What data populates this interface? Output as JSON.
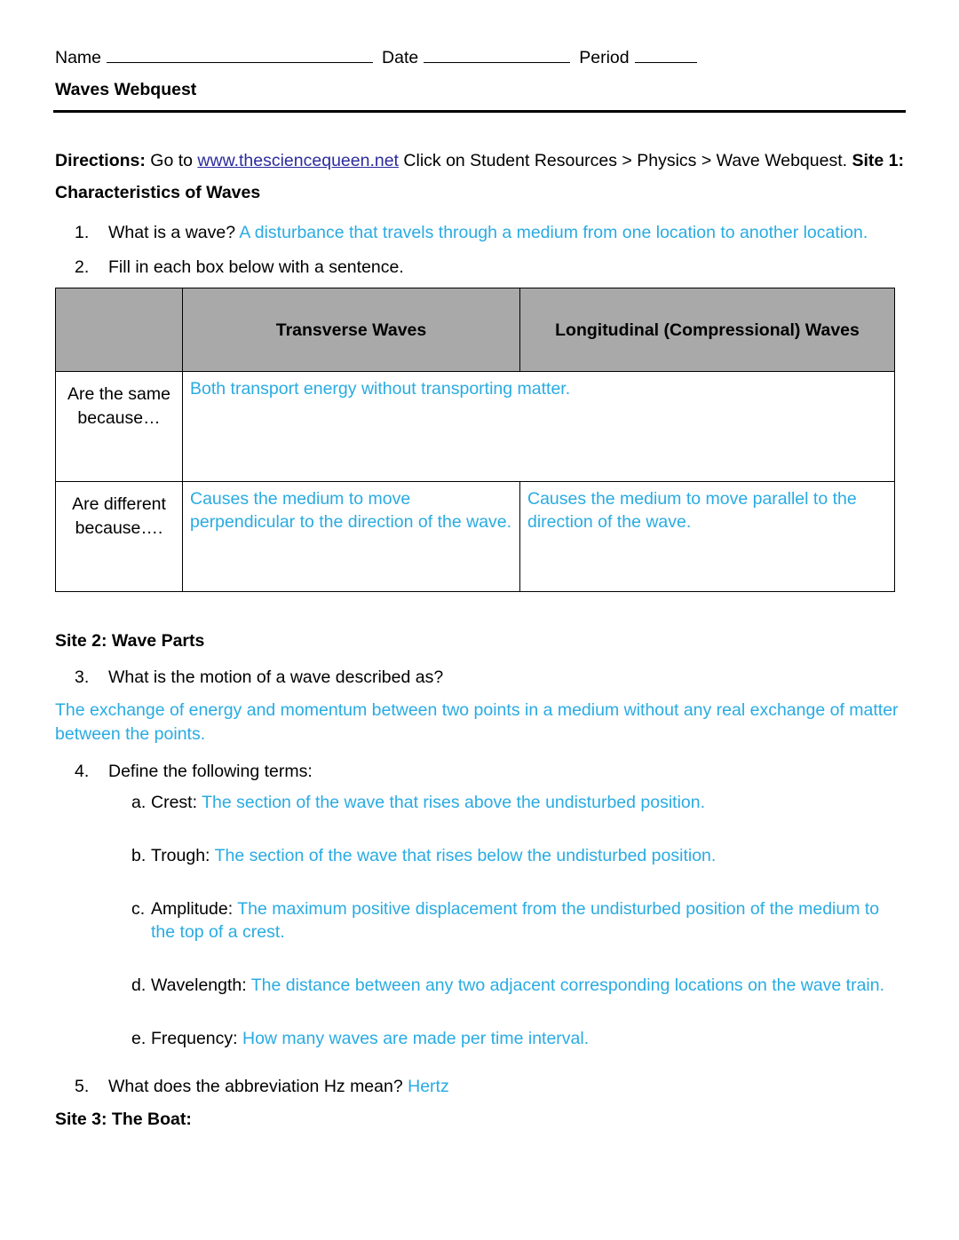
{
  "header": {
    "name_label": "Name",
    "date_label": "Date",
    "period_label": "Period",
    "doc_title": "Waves Webquest"
  },
  "directions": {
    "label": "Directions:",
    "pre_link": "Go to ",
    "link_text": "www.thesciencequeen.net",
    "post_link": " Click on Student Resources > Physics > Wave Webquest. ",
    "site1_heading": "Site 1: Characteristics of Waves"
  },
  "questions": {
    "q1": {
      "number": "1.",
      "prompt": "What is a wave?",
      "answer": "A disturbance that travels through a medium from one location to another location."
    },
    "q2": {
      "number": "2.",
      "prompt": "Fill in each box below with a sentence."
    },
    "q3": {
      "number": "3.",
      "prompt": "What is the motion of a wave described as?",
      "answer": "The exchange of energy and momentum between two points in a medium without any real exchange of matter between the points."
    },
    "q4": {
      "number": "4.",
      "prompt": "Define the following terms:"
    },
    "q5": {
      "number": "5.",
      "prompt": "What does the abbreviation Hz mean?",
      "answer": "Hertz"
    }
  },
  "wave_table": {
    "header": {
      "corner": "",
      "col2": "Transverse Waves",
      "col3": "Longitudinal (Compressional) Waves"
    },
    "rows": [
      {
        "label": "Are the same because…",
        "merged": true,
        "col2": "Both transport energy without transporting matter.",
        "col3": ""
      },
      {
        "label": "Are different because….",
        "merged": false,
        "col2": "Causes the medium to move perpendicular to the direction of the wave.",
        "col3": "Causes the medium to move parallel to the direction of the wave."
      }
    ]
  },
  "site2": {
    "heading": "Site 2: Wave Parts"
  },
  "definitions": [
    {
      "letter": "a.",
      "term": "Crest:",
      "answer": "The section of the wave that rises above the undisturbed position."
    },
    {
      "letter": "b.",
      "term": "Trough:",
      "answer": "The section of the wave that rises below the undisturbed position."
    },
    {
      "letter": "c.",
      "term": "Amplitude:",
      "answer": "The maximum positive displacement from the undisturbed position of the medium to the top of a crest."
    },
    {
      "letter": "d.",
      "term": "Wavelength:",
      "answer": "The distance between any two adjacent corresponding locations on the wave train."
    },
    {
      "letter": "e.",
      "term": "Frequency:",
      "answer": "How many waves are made per time interval."
    }
  ],
  "site3": {
    "heading": "Site 3: The Boat:"
  },
  "colors": {
    "answer_blue": "#29abe2",
    "table_header_gray": "#a9a9a9",
    "link_blue": "#2b2b9e",
    "text_black": "#000000"
  }
}
